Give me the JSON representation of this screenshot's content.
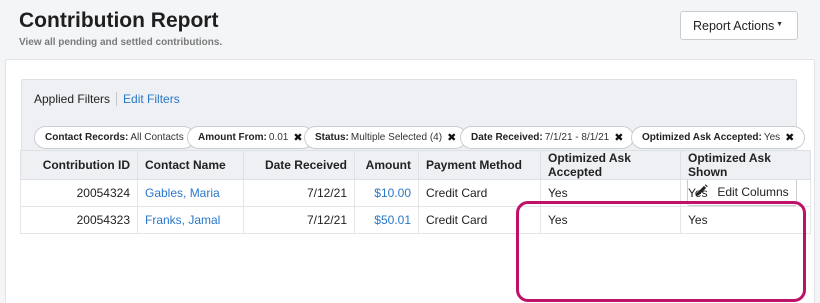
{
  "header": {
    "title": "Contribution Report",
    "subtitle": "View all pending and settled contributions.",
    "actions_label": "Report Actions",
    "actions_caret": "▼"
  },
  "filters": {
    "label": "Applied Filters",
    "edit_label": "Edit Filters",
    "chips": [
      {
        "key": "Contact Records:",
        "value": "All Contacts",
        "removable": false
      },
      {
        "key": "Amount From:",
        "value": "0.01",
        "removable": true
      },
      {
        "key": "Status:",
        "value": "Multiple Selected (4)",
        "removable": true
      },
      {
        "key": "Date Received:",
        "value": "7/1/21 - 8/1/21",
        "removable": true
      },
      {
        "key": "Optimized Ask Accepted:",
        "value": "Yes",
        "removable": true
      }
    ],
    "remove_glyph": "✖"
  },
  "table_toolbar": {
    "edit_columns_label": "Edit Columns"
  },
  "table": {
    "columns": [
      "Contribution ID",
      "Contact Name",
      "Date Received",
      "Amount",
      "Payment Method",
      "Optimized Ask Accepted",
      "Optimized Ask Shown"
    ],
    "rows": [
      {
        "id": "20054324",
        "name": "Gables, Maria",
        "date": "7/12/21",
        "amount": "$10.00",
        "method": "Credit Card",
        "accepted": "Yes",
        "shown": "Yes"
      },
      {
        "id": "20054323",
        "name": "Franks, Jamal",
        "date": "7/12/21",
        "amount": "$50.01",
        "method": "Credit Card",
        "accepted": "Yes",
        "shown": "Yes"
      }
    ]
  },
  "colors": {
    "link": "#2a77c9",
    "highlight": "#c0116a"
  }
}
